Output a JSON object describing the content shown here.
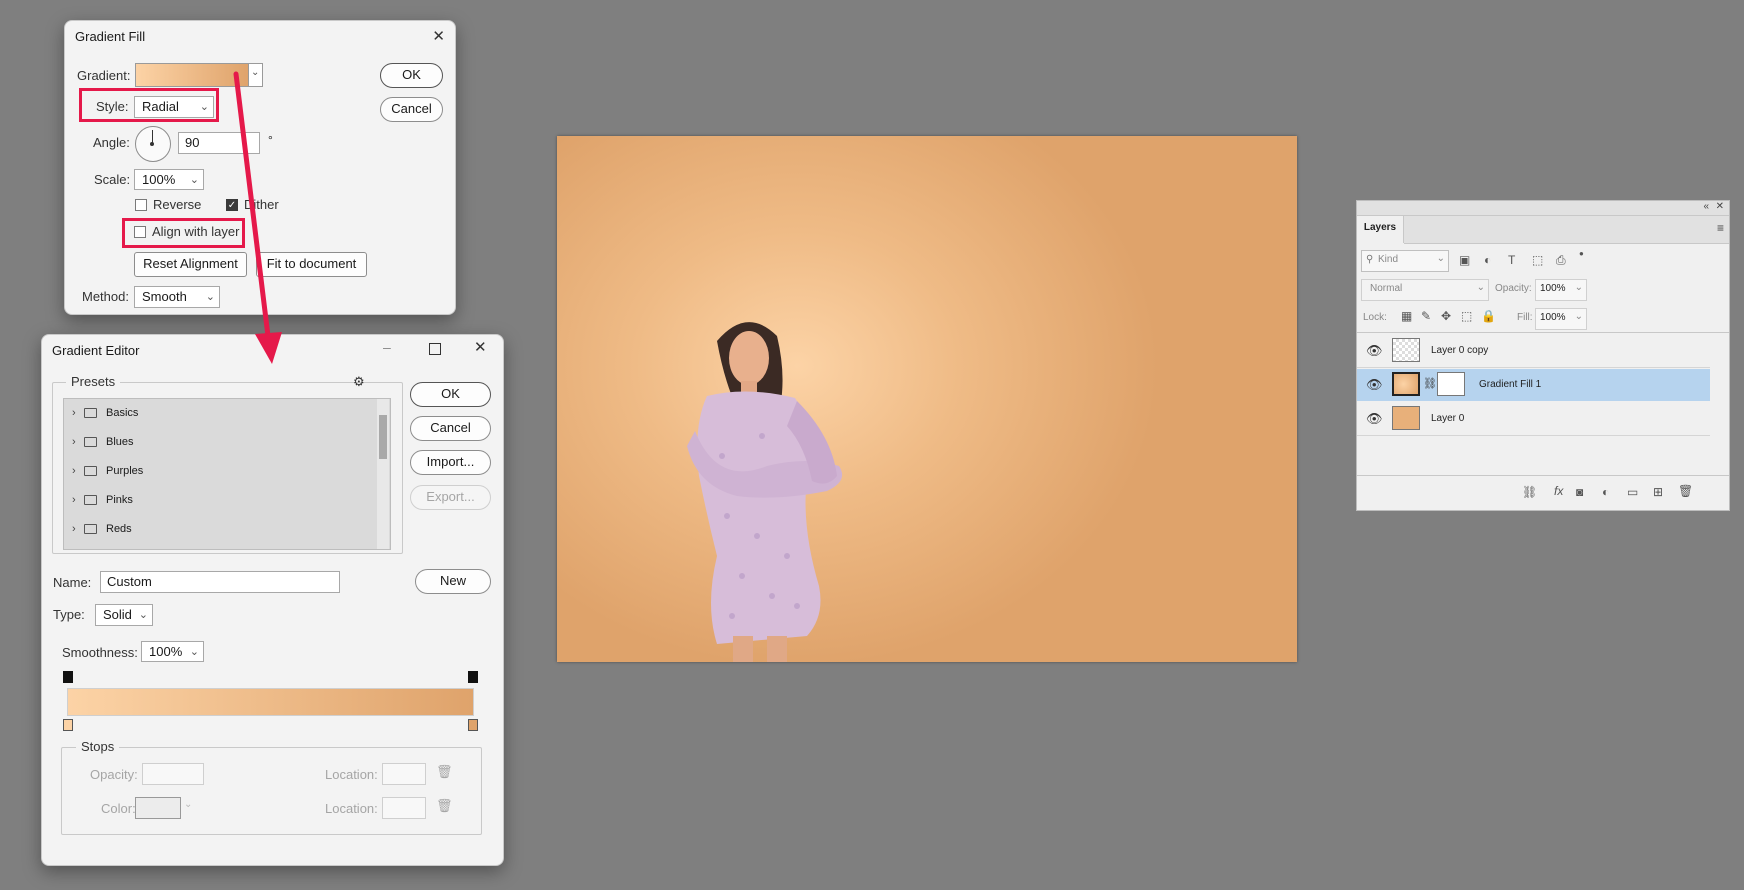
{
  "gradient_fill": {
    "title": "Gradient Fill",
    "gradient_label": "Gradient:",
    "style_label": "Style:",
    "style_value": "Radial",
    "angle_label": "Angle:",
    "angle_value": "90",
    "angle_unit": "°",
    "scale_label": "Scale:",
    "scale_value": "100%",
    "reverse_label": "Reverse",
    "reverse_checked": false,
    "dither_label": "Dither",
    "dither_checked": true,
    "align_label": "Align with layer",
    "align_checked": false,
    "reset_alignment": "Reset Alignment",
    "fit_to_document": "Fit to document",
    "method_label": "Method:",
    "method_value": "Smooth",
    "ok": "OK",
    "cancel": "Cancel",
    "close": "✕"
  },
  "gradient_editor": {
    "title": "Gradient Editor",
    "presets_label": "Presets",
    "presets": [
      "Basics",
      "Blues",
      "Purples",
      "Pinks",
      "Reds"
    ],
    "ok": "OK",
    "cancel": "Cancel",
    "import": "Import...",
    "export": "Export...",
    "name_label": "Name:",
    "name_value": "Custom",
    "new": "New",
    "type_label": "Type:",
    "type_value": "Solid",
    "smoothness_label": "Smoothness:",
    "smoothness_value": "100%",
    "stops_label": "Stops",
    "opacity_label": "Opacity:",
    "color_label": "Color:",
    "location_label": "Location:",
    "location_label_2": "Location:"
  },
  "layers": {
    "title": "Layers",
    "kind_placeholder": "Kind",
    "blend_mode": "Normal",
    "opacity_label": "Opacity:",
    "opacity_value": "100%",
    "lock_label": "Lock:",
    "fill_label": "Fill:",
    "fill_value": "100%",
    "items": [
      {
        "name": "Layer 0 copy",
        "selected": false
      },
      {
        "name": "Gradient Fill 1",
        "selected": true
      },
      {
        "name": "Layer 0",
        "selected": false
      }
    ],
    "footer_fx": "fx"
  },
  "colors": {
    "gradient_start": "#fcd3a6",
    "gradient_end": "#dfa36b",
    "highlight": "#e5194a",
    "selection": "#b6d3ee",
    "canvas_bg": "#7f7f7f"
  }
}
